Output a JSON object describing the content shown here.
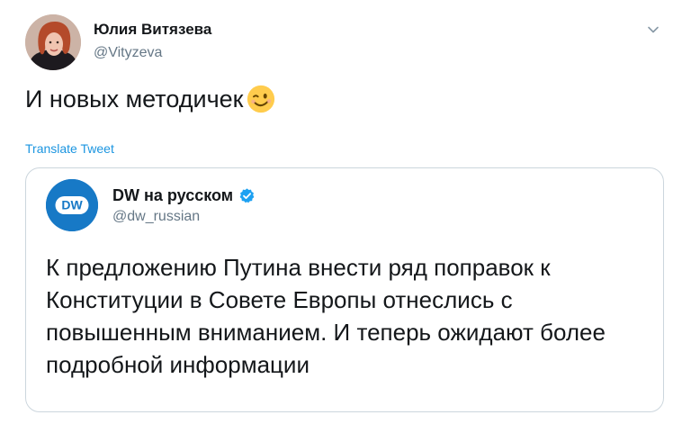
{
  "tweet": {
    "author": {
      "name": "Юлия Витязева",
      "handle": "@Vityzeva"
    },
    "text": "И новых методичек",
    "emoji": "wink-face",
    "translate_label": "Translate Tweet"
  },
  "quoted_tweet": {
    "author": {
      "name": "DW на русском",
      "handle": "@dw_russian",
      "verified": true,
      "avatar_text": "DW"
    },
    "text": "К предложению Путина внести ряд поправок к Конституции в Совете Европы отнеслись с повышенным вниманием. И теперь ожидают более подробной информации"
  },
  "colors": {
    "link": "#1b95e0",
    "secondary_text": "#657786",
    "border": "#ccd6dd",
    "dw_blue": "#1779c6",
    "verified": "#1da1f2"
  },
  "icons": [
    "chevron-down-icon",
    "wink-emoji-icon",
    "verified-badge-icon"
  ]
}
